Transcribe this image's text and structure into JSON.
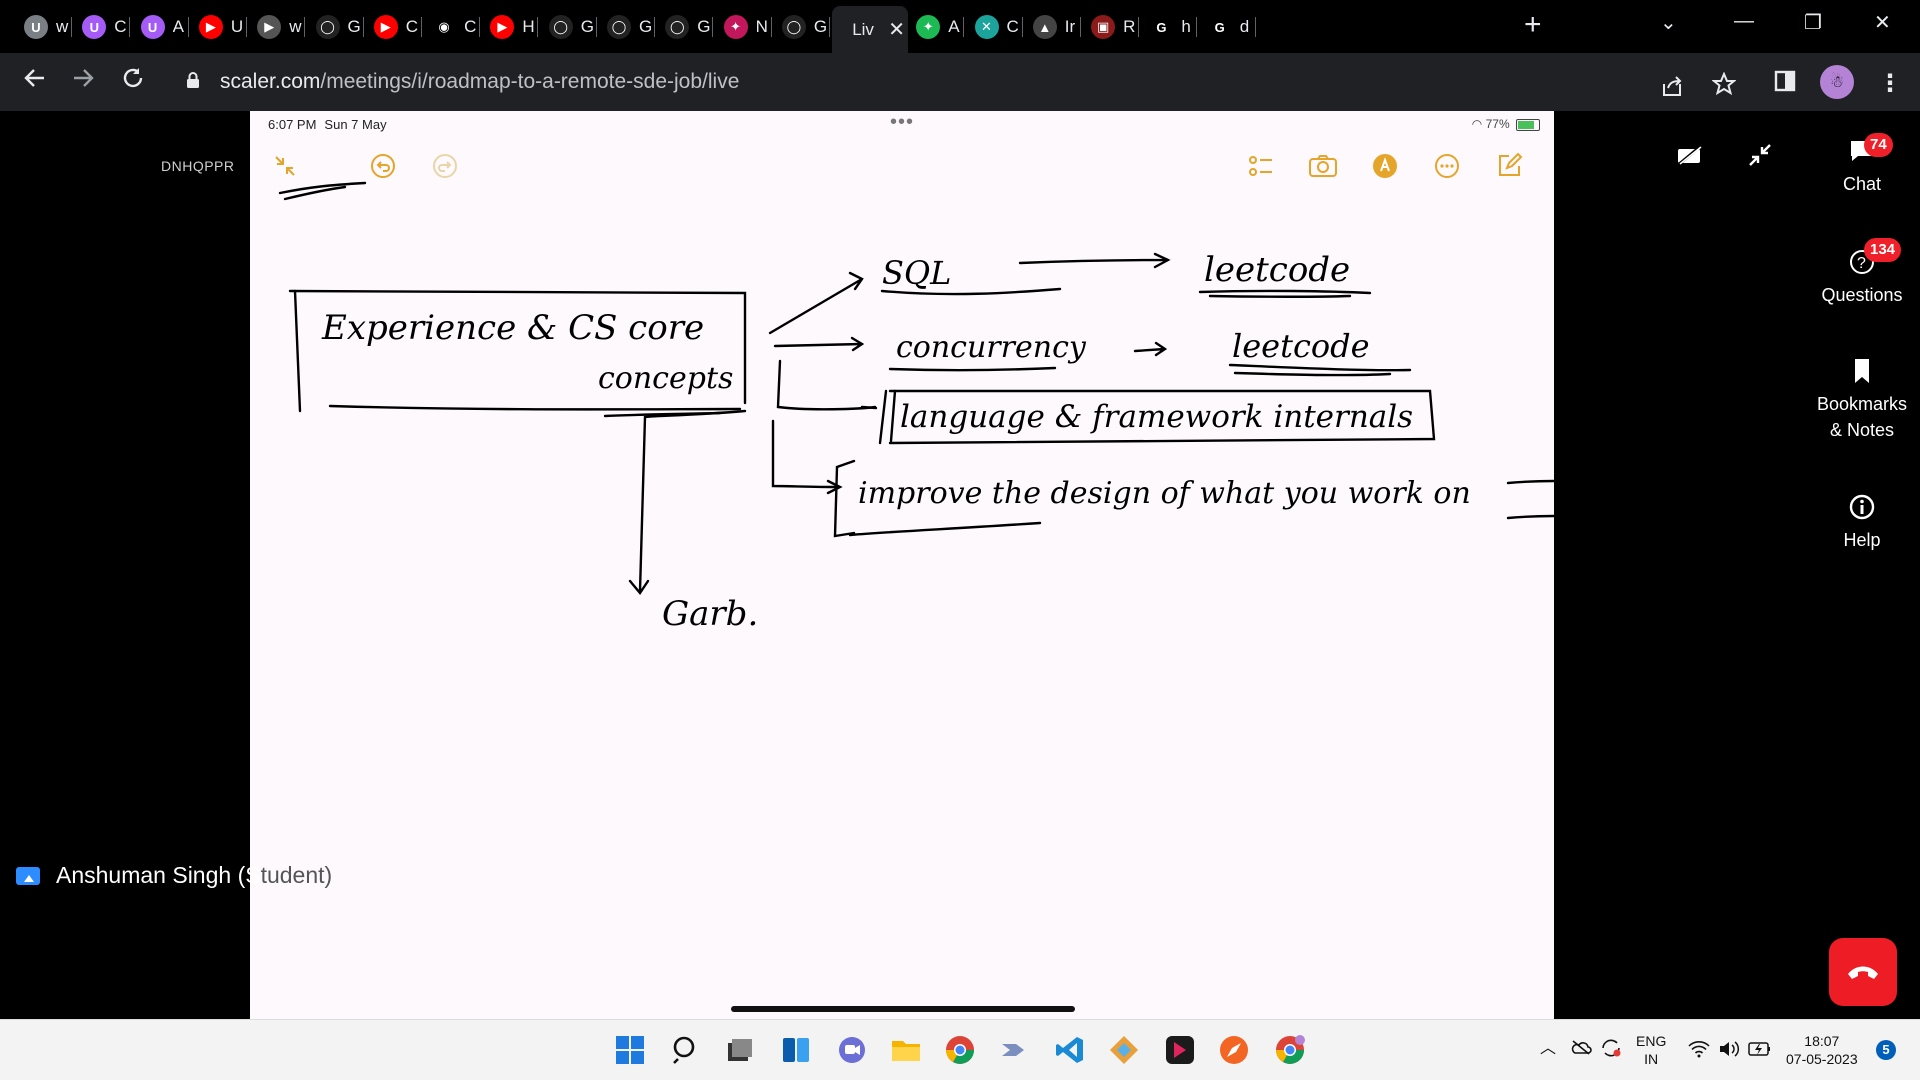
{
  "browser": {
    "tabs": [
      {
        "letter": "w",
        "favicon": "U",
        "color": "#7a7f86"
      },
      {
        "letter": "C",
        "favicon": "U",
        "color": "#a55cf7"
      },
      {
        "letter": "A",
        "favicon": "U",
        "color": "#a55cf7"
      },
      {
        "letter": "U",
        "favicon": "▶",
        "color": "#ff0000"
      },
      {
        "letter": "w",
        "favicon": "▶",
        "color": "#555"
      },
      {
        "letter": "G",
        "favicon": "◯",
        "color": "#222"
      },
      {
        "letter": "C",
        "favicon": "▶",
        "color": "#ff0000"
      },
      {
        "letter": "C",
        "favicon": "◉",
        "color": "#fff"
      },
      {
        "letter": "H",
        "favicon": "▶",
        "color": "#ff0000"
      },
      {
        "letter": "G",
        "favicon": "◯",
        "color": "#222"
      },
      {
        "letter": "G",
        "favicon": "◯",
        "color": "#222"
      },
      {
        "letter": "G",
        "favicon": "◯",
        "color": "#222"
      },
      {
        "letter": "N",
        "favicon": "✦",
        "color": "#c2185b"
      },
      {
        "letter": "G",
        "favicon": "◯",
        "color": "#222"
      }
    ],
    "active_tab": {
      "title": "Liv",
      "close": "✕"
    },
    "tabs_after": [
      {
        "letter": "A",
        "favicon": "✦",
        "color": "#1db954"
      },
      {
        "letter": "C",
        "favicon": "✕",
        "color": "#1ba39c"
      },
      {
        "letter": "Ir",
        "favicon": "▲",
        "color": "#444"
      },
      {
        "letter": "R",
        "favicon": "▣",
        "color": "#8b1a1a"
      },
      {
        "letter": "h",
        "favicon": "G",
        "color": "#fff"
      },
      {
        "letter": "d",
        "favicon": "G",
        "color": "#fff"
      }
    ],
    "new_tab": "+",
    "url_domain": "scaler.com",
    "url_path": "/meetings/i/roadmap-to-a-remote-sde-job/live"
  },
  "meeting": {
    "room_code": "DNHQPPR",
    "presenter_name": "Anshuman Singh (S",
    "presenter_name_cut": "tudent)"
  },
  "ipad": {
    "time": "6:07 PM",
    "date": "Sun 7 May",
    "battery": "77%"
  },
  "whiteboard": {
    "main_box": [
      "Experience & CS core",
      "concepts"
    ],
    "branches": [
      {
        "label": "SQL",
        "target": "leetcode"
      },
      {
        "label": "concurrency",
        "target": "leetcode"
      },
      {
        "label": "language & framework internals",
        "target": ""
      },
      {
        "label": "improve the design of what you work on",
        "target": ""
      }
    ],
    "down_label": "Garb."
  },
  "sidepanel": {
    "chat_label": "Chat",
    "chat_count": "74",
    "questions_label": "Questions",
    "questions_count": "134",
    "bookmarks_label": "Bookmarks & Notes",
    "help_label": "Help"
  },
  "taskbar": {
    "lang_top": "ENG",
    "lang_bottom": "IN",
    "clock_time": "18:07",
    "clock_date": "07-05-2023",
    "notifications": "5"
  }
}
